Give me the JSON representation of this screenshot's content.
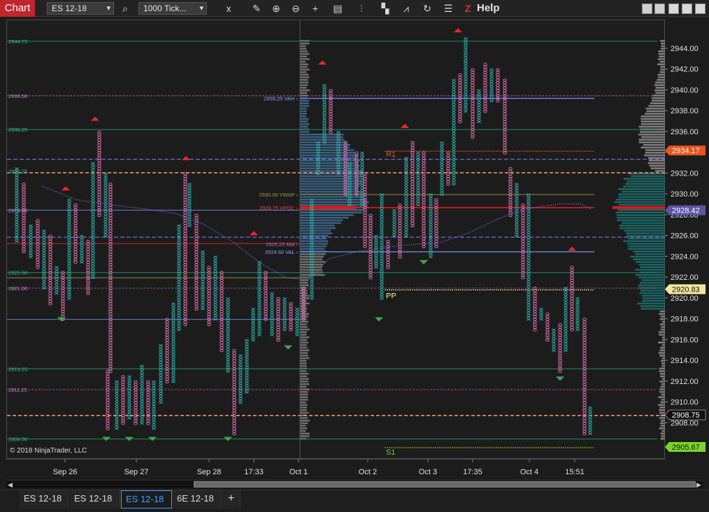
{
  "toolbar": {
    "title": "Chart",
    "instrument": "ES 12-18",
    "interval": "1000 Tick...",
    "help": "Help",
    "tools": [
      {
        "icon": "search-icon",
        "label": "⌕"
      },
      {
        "icon": "properties-icon",
        "label": "x"
      },
      {
        "icon": "pencil-icon",
        "label": "✎"
      },
      {
        "icon": "zoom-in-icon",
        "label": "⊕"
      },
      {
        "icon": "zoom-out-icon",
        "label": "⊖"
      },
      {
        "icon": "crosshair-icon",
        "label": "+"
      },
      {
        "icon": "data-box-icon",
        "label": "▤"
      },
      {
        "icon": "bar-type-icon",
        "label": "⫶"
      },
      {
        "icon": "chart-style-icon",
        "label": "▚"
      },
      {
        "icon": "drawing-tools-icon",
        "label": "⩘"
      },
      {
        "icon": "refresh-icon",
        "label": "↻"
      },
      {
        "icon": "indicators-icon",
        "label": "☰"
      },
      {
        "icon": "z-order-icon",
        "label": "Z"
      }
    ]
  },
  "y_ticks": [
    "2944.00",
    "2942.00",
    "2940.00",
    "2938.00",
    "2936.00",
    "2934.00",
    "2932.00",
    "2930.00",
    "2928.00",
    "2926.00",
    "2924.00",
    "2922.00",
    "2920.00",
    "2918.00",
    "2916.00",
    "2914.00",
    "2912.00",
    "2910.00",
    "2908.00"
  ],
  "price_markers": [
    {
      "label": "2934.17",
      "bg": "#e8531f",
      "fg": "#ffffff"
    },
    {
      "label": "2928.42",
      "bg": "#5a55a8",
      "fg": "#ffffff"
    },
    {
      "label": "2920.83",
      "bg": "#f4e6a0",
      "fg": "#111111"
    },
    {
      "label": "2908.75",
      "bg": "#111111",
      "fg": "#ffffff"
    },
    {
      "label": "2905.67",
      "bg": "#7ad62a",
      "fg": "#111111"
    }
  ],
  "left_levels": [
    "2944.75",
    "2939.50",
    "2936.25",
    "2932.25",
    "2928.50",
    "2922.50",
    "2921.00",
    "2913.25",
    "2911.25",
    "2906.50"
  ],
  "profile_labels": {
    "vah": "2939.25 VAH",
    "vwap": "2930.00 VWAP",
    "vpoc": "2928.75 VPOC",
    "mid": "2925.25 Mid",
    "val": "2924.50 VAL"
  },
  "pivot_labels": {
    "r1": "R1",
    "pp": "PP",
    "s1": "S1"
  },
  "copyright": "© 2018 NinjaTrader, LLC",
  "x_ticks": [
    "Sep 26",
    "Sep 27",
    "Sep 28",
    "17:33",
    "Oct 1",
    "Oct 2",
    "Oct 3",
    "17:35",
    "Oct 4",
    "15:51"
  ],
  "tabs": [
    "ES 12-18",
    "ES 12-18",
    "ES 12-18",
    "6E 12-18"
  ],
  "active_tab": 2,
  "colors": {
    "x_bull": "#2fb3b0",
    "o_bear": "#e272b0",
    "vpoc": "#e01818",
    "vah_val": "#6f8fff",
    "vwap": "#8a8a3a",
    "dashed_purple": "#6e6ad6",
    "orange_dash": "#ff9b73",
    "pivot_r1": "#e8531f",
    "pivot_pp": "#f5ec9a",
    "pivot_s1": "#7ad62a"
  }
}
